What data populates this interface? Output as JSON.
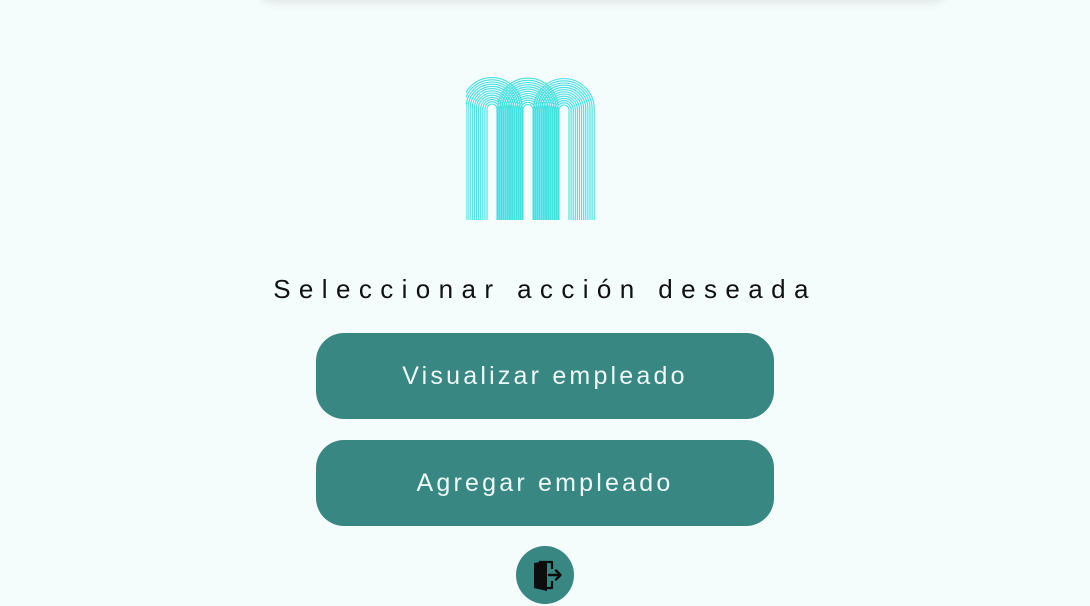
{
  "logo": {
    "icon": "wave-m-logo",
    "color": "#44e0e0"
  },
  "heading": "Seleccionar acción deseada",
  "actions": {
    "view_employee": "Visualizar empleado",
    "add_employee": "Agregar empleado"
  },
  "exit": {
    "icon": "exit-door-icon"
  },
  "colors": {
    "background": "#f5fcfc",
    "button": "#388782",
    "button_text": "#eef8f7",
    "logo": "#44e0e0"
  }
}
